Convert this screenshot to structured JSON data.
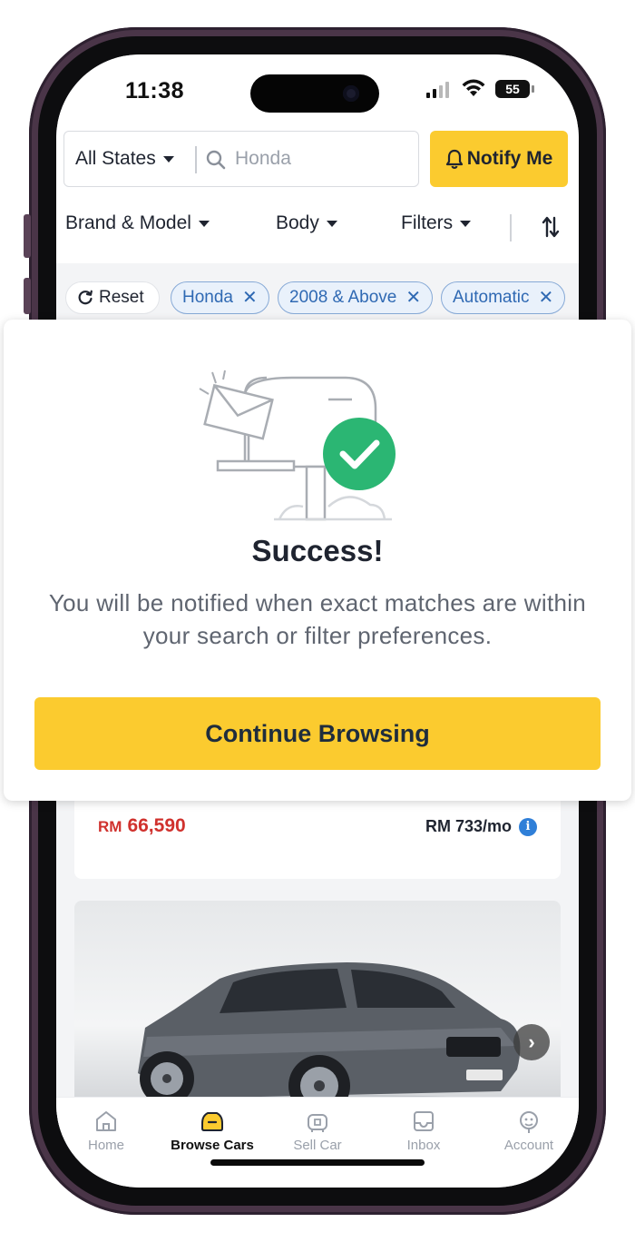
{
  "status_bar": {
    "time": "11:38",
    "battery": "55"
  },
  "search": {
    "state": "All States",
    "placeholder": "Honda",
    "notify_label": "Notify Me"
  },
  "filters": {
    "brand_model": "Brand & Model",
    "body": "Body",
    "filters": "Filters"
  },
  "chips": {
    "reset": "Reset",
    "tags": [
      "Honda",
      "2008 & Above",
      "Automatic"
    ]
  },
  "listing": {
    "price_currency": "RM",
    "price_value": "66,590",
    "monthly": "RM 733/mo"
  },
  "modal": {
    "title": "Success!",
    "message": "You will be notified when exact matches are within your search or filter preferences.",
    "button": "Continue Browsing"
  },
  "tabs": [
    {
      "label": "Home",
      "icon": "home-icon",
      "active": false
    },
    {
      "label": "Browse Cars",
      "icon": "car-icon",
      "active": true
    },
    {
      "label": "Sell Car",
      "icon": "sell-tag-icon",
      "active": false
    },
    {
      "label": "Inbox",
      "icon": "inbox-icon",
      "active": false
    },
    {
      "label": "Account",
      "icon": "account-icon",
      "active": false
    }
  ],
  "colors": {
    "accent": "#fbcb2f",
    "price": "#d0312d",
    "chip_text": "#2f69b3",
    "success": "#2bb673"
  }
}
